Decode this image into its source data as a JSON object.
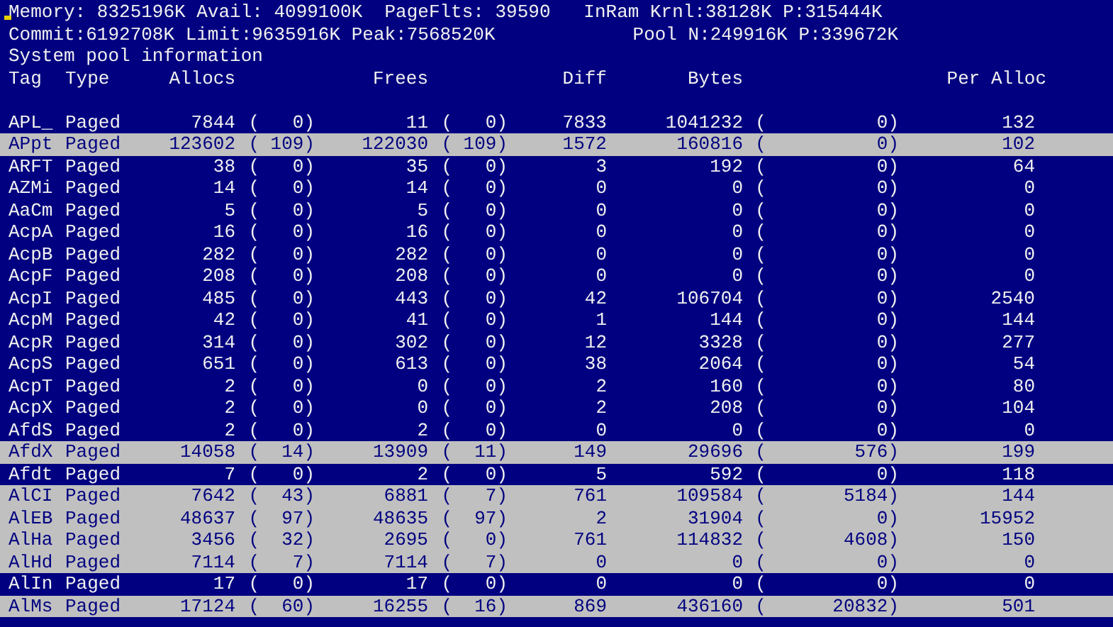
{
  "memory_line": "Memory: 8325196K Avail: 4099100K  PageFlts: 39590   InRam Krnl:38128K P:315444K",
  "commit_line": "Commit:6192708K Limit:9635916K Peak:7568520K",
  "pool_line": "Pool N:249916K P:339672K",
  "section_title": "System pool information",
  "columns": {
    "tag": "Tag",
    "type": "Type",
    "allocs": "Allocs",
    "frees": "Frees",
    "diff": "Diff",
    "bytes": "Bytes",
    "per_alloc": "Per Alloc"
  },
  "rows": [
    {
      "tag": "APL_",
      "type": "Paged",
      "allocs": "7844",
      "allocs_delta": "(   0)",
      "frees": "11",
      "frees_delta": "(   0)",
      "diff": "7833",
      "bytes": "1041232",
      "bytes_delta": "(          0)",
      "per_alloc": "132",
      "highlighted": false
    },
    {
      "tag": "APpt",
      "type": "Paged",
      "allocs": "123602",
      "allocs_delta": "( 109)",
      "frees": "122030",
      "frees_delta": "( 109)",
      "diff": "1572",
      "bytes": "160816",
      "bytes_delta": "(          0)",
      "per_alloc": "102",
      "highlighted": true
    },
    {
      "tag": "ARFT",
      "type": "Paged",
      "allocs": "38",
      "allocs_delta": "(   0)",
      "frees": "35",
      "frees_delta": "(   0)",
      "diff": "3",
      "bytes": "192",
      "bytes_delta": "(          0)",
      "per_alloc": "64",
      "highlighted": false
    },
    {
      "tag": "AZMi",
      "type": "Paged",
      "allocs": "14",
      "allocs_delta": "(   0)",
      "frees": "14",
      "frees_delta": "(   0)",
      "diff": "0",
      "bytes": "0",
      "bytes_delta": "(          0)",
      "per_alloc": "0",
      "highlighted": false
    },
    {
      "tag": "AaCm",
      "type": "Paged",
      "allocs": "5",
      "allocs_delta": "(   0)",
      "frees": "5",
      "frees_delta": "(   0)",
      "diff": "0",
      "bytes": "0",
      "bytes_delta": "(          0)",
      "per_alloc": "0",
      "highlighted": false
    },
    {
      "tag": "AcpA",
      "type": "Paged",
      "allocs": "16",
      "allocs_delta": "(   0)",
      "frees": "16",
      "frees_delta": "(   0)",
      "diff": "0",
      "bytes": "0",
      "bytes_delta": "(          0)",
      "per_alloc": "0",
      "highlighted": false
    },
    {
      "tag": "AcpB",
      "type": "Paged",
      "allocs": "282",
      "allocs_delta": "(   0)",
      "frees": "282",
      "frees_delta": "(   0)",
      "diff": "0",
      "bytes": "0",
      "bytes_delta": "(          0)",
      "per_alloc": "0",
      "highlighted": false
    },
    {
      "tag": "AcpF",
      "type": "Paged",
      "allocs": "208",
      "allocs_delta": "(   0)",
      "frees": "208",
      "frees_delta": "(   0)",
      "diff": "0",
      "bytes": "0",
      "bytes_delta": "(          0)",
      "per_alloc": "0",
      "highlighted": false
    },
    {
      "tag": "AcpI",
      "type": "Paged",
      "allocs": "485",
      "allocs_delta": "(   0)",
      "frees": "443",
      "frees_delta": "(   0)",
      "diff": "42",
      "bytes": "106704",
      "bytes_delta": "(          0)",
      "per_alloc": "2540",
      "highlighted": false
    },
    {
      "tag": "AcpM",
      "type": "Paged",
      "allocs": "42",
      "allocs_delta": "(   0)",
      "frees": "41",
      "frees_delta": "(   0)",
      "diff": "1",
      "bytes": "144",
      "bytes_delta": "(          0)",
      "per_alloc": "144",
      "highlighted": false
    },
    {
      "tag": "AcpR",
      "type": "Paged",
      "allocs": "314",
      "allocs_delta": "(   0)",
      "frees": "302",
      "frees_delta": "(   0)",
      "diff": "12",
      "bytes": "3328",
      "bytes_delta": "(          0)",
      "per_alloc": "277",
      "highlighted": false
    },
    {
      "tag": "AcpS",
      "type": "Paged",
      "allocs": "651",
      "allocs_delta": "(   0)",
      "frees": "613",
      "frees_delta": "(   0)",
      "diff": "38",
      "bytes": "2064",
      "bytes_delta": "(          0)",
      "per_alloc": "54",
      "highlighted": false
    },
    {
      "tag": "AcpT",
      "type": "Paged",
      "allocs": "2",
      "allocs_delta": "(   0)",
      "frees": "0",
      "frees_delta": "(   0)",
      "diff": "2",
      "bytes": "160",
      "bytes_delta": "(          0)",
      "per_alloc": "80",
      "highlighted": false
    },
    {
      "tag": "AcpX",
      "type": "Paged",
      "allocs": "2",
      "allocs_delta": "(   0)",
      "frees": "0",
      "frees_delta": "(   0)",
      "diff": "2",
      "bytes": "208",
      "bytes_delta": "(          0)",
      "per_alloc": "104",
      "highlighted": false
    },
    {
      "tag": "AfdS",
      "type": "Paged",
      "allocs": "2",
      "allocs_delta": "(   0)",
      "frees": "2",
      "frees_delta": "(   0)",
      "diff": "0",
      "bytes": "0",
      "bytes_delta": "(          0)",
      "per_alloc": "0",
      "highlighted": false
    },
    {
      "tag": "AfdX",
      "type": "Paged",
      "allocs": "14058",
      "allocs_delta": "(  14)",
      "frees": "13909",
      "frees_delta": "(  11)",
      "diff": "149",
      "bytes": "29696",
      "bytes_delta": "(        576)",
      "per_alloc": "199",
      "highlighted": true
    },
    {
      "tag": "Afdt",
      "type": "Paged",
      "allocs": "7",
      "allocs_delta": "(   0)",
      "frees": "2",
      "frees_delta": "(   0)",
      "diff": "5",
      "bytes": "592",
      "bytes_delta": "(          0)",
      "per_alloc": "118",
      "highlighted": false
    },
    {
      "tag": "AlCI",
      "type": "Paged",
      "allocs": "7642",
      "allocs_delta": "(  43)",
      "frees": "6881",
      "frees_delta": "(   7)",
      "diff": "761",
      "bytes": "109584",
      "bytes_delta": "(       5184)",
      "per_alloc": "144",
      "highlighted": true
    },
    {
      "tag": "AlEB",
      "type": "Paged",
      "allocs": "48637",
      "allocs_delta": "(  97)",
      "frees": "48635",
      "frees_delta": "(  97)",
      "diff": "2",
      "bytes": "31904",
      "bytes_delta": "(          0)",
      "per_alloc": "15952",
      "highlighted": true
    },
    {
      "tag": "AlHa",
      "type": "Paged",
      "allocs": "3456",
      "allocs_delta": "(  32)",
      "frees": "2695",
      "frees_delta": "(   0)",
      "diff": "761",
      "bytes": "114832",
      "bytes_delta": "(       4608)",
      "per_alloc": "150",
      "highlighted": true
    },
    {
      "tag": "AlHd",
      "type": "Paged",
      "allocs": "7114",
      "allocs_delta": "(   7)",
      "frees": "7114",
      "frees_delta": "(   7)",
      "diff": "0",
      "bytes": "0",
      "bytes_delta": "(          0)",
      "per_alloc": "0",
      "highlighted": true
    },
    {
      "tag": "AlIn",
      "type": "Paged",
      "allocs": "17",
      "allocs_delta": "(   0)",
      "frees": "17",
      "frees_delta": "(   0)",
      "diff": "0",
      "bytes": "0",
      "bytes_delta": "(          0)",
      "per_alloc": "0",
      "highlighted": false
    },
    {
      "tag": "AlMs",
      "type": "Paged",
      "allocs": "17124",
      "allocs_delta": "(  60)",
      "frees": "16255",
      "frees_delta": "(  16)",
      "diff": "869",
      "bytes": "436160",
      "bytes_delta": "(      20832)",
      "per_alloc": "501",
      "highlighted": true
    }
  ]
}
